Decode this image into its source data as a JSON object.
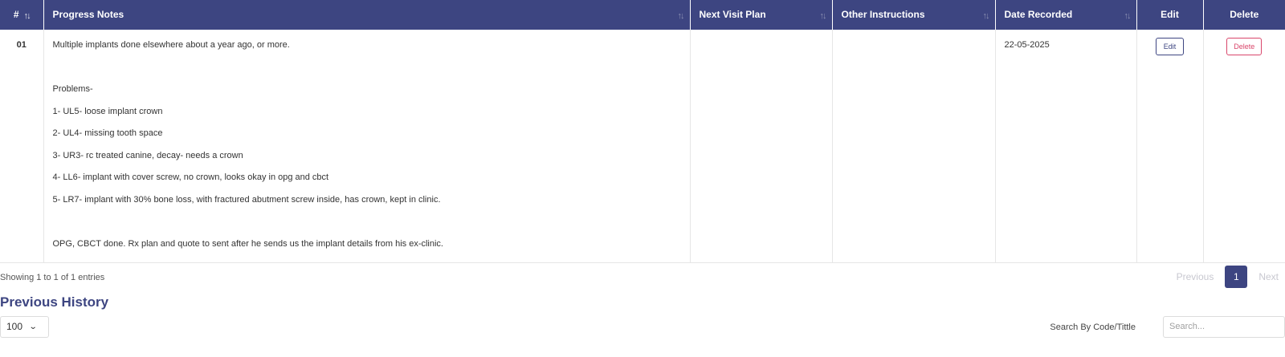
{
  "table": {
    "columns": {
      "index": "#",
      "progress_notes": "Progress Notes",
      "next_visit_plan": "Next Visit Plan",
      "other_instructions": "Other Instructions",
      "date_recorded": "Date Recorded",
      "edit": "Edit",
      "delete": "Delete"
    },
    "sort_icon": "sort-arrows-icon",
    "rows": [
      {
        "index": "01",
        "notes": [
          "Multiple implants done elsewhere about a year ago, or more.",
          "",
          "Problems-",
          "1- UL5- loose implant crown",
          "2- UL4- missing tooth space",
          "3- UR3- rc treated canine, decay- needs a crown",
          "4- LL6- implant with cover screw, no crown, looks okay in opg and cbct",
          "5- LR7- implant with 30% bone loss, with fractured abutment screw inside, has crown, kept in clinic.",
          "",
          "OPG, CBCT done. Rx plan and quote to sent after he sends us the implant details from his ex-clinic."
        ],
        "next_visit_plan": "",
        "other_instructions": "",
        "date_recorded": "22-05-2025",
        "edit_label": "Edit",
        "delete_label": "Delete"
      }
    ]
  },
  "footer": {
    "showing": "Showing 1 to 1 of 1 entries",
    "previous": "Previous",
    "current_page": "1",
    "next": "Next"
  },
  "history": {
    "title": "Previous History",
    "page_size": "100",
    "search_label": "Search By Code/Tittle",
    "search_placeholder": "Search...",
    "search_value": ""
  },
  "colors": {
    "header_bg": "#3d4581",
    "accent": "#3d4581",
    "delete": "#d9466b"
  }
}
